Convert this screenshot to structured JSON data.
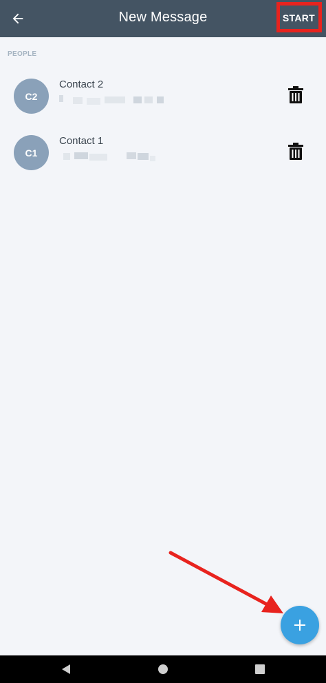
{
  "app_bar": {
    "title": "New Message",
    "back_icon": "arrow-left-icon",
    "start_label": "START"
  },
  "people": {
    "section_label": "PEOPLE",
    "contacts": [
      {
        "initials": "C2",
        "name": "Contact 2"
      },
      {
        "initials": "C1",
        "name": "Contact 1"
      }
    ]
  },
  "fab": {
    "icon": "plus-icon"
  },
  "nav": {
    "back_icon": "triangle-back-icon",
    "home_icon": "circle-home-icon",
    "recents_icon": "square-recents-icon"
  },
  "colors": {
    "app_bar": "#445463",
    "background": "#f3f5f9",
    "avatar": "#8aa1b9",
    "fab": "#3aa1e1",
    "annotation": "#e8231e"
  }
}
